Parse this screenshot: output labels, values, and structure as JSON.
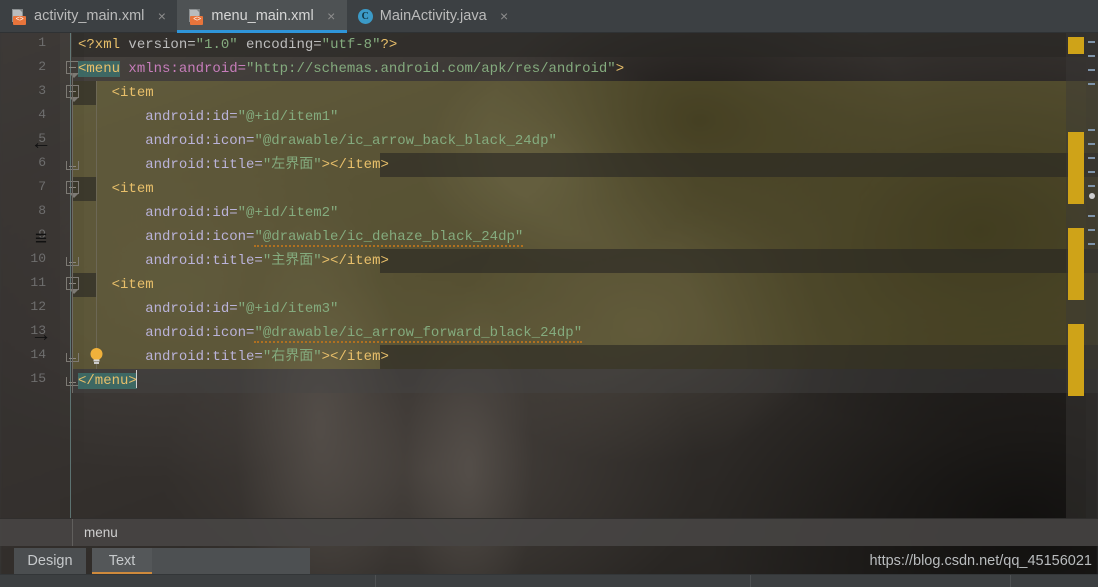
{
  "window": {
    "tabs": [
      {
        "label": "activity_main.xml",
        "icon": "xml-file-icon",
        "active": false,
        "close": "×"
      },
      {
        "label": "menu_main.xml",
        "icon": "xml-file-icon",
        "active": true,
        "close": "×"
      },
      {
        "label": "MainActivity.java",
        "icon": "java-class-icon",
        "active": false,
        "close": "×"
      }
    ]
  },
  "editor": {
    "line_numbers": [
      "1",
      "2",
      "3",
      "4",
      "5",
      "6",
      "7",
      "8",
      "9",
      "10",
      "11",
      "12",
      "13",
      "14",
      "15"
    ],
    "gutter_icons": [
      {
        "line": 5,
        "name": "arrow-back-icon",
        "glyph": "←"
      },
      {
        "line": 9,
        "name": "dehaze-icon",
        "glyph": "≡"
      },
      {
        "line": 13,
        "name": "arrow-forward-icon",
        "glyph": "→"
      },
      {
        "line": 14,
        "name": "intention-bulb-icon",
        "glyph": "💡"
      }
    ],
    "lines": [
      {
        "n": 1,
        "text": "<?xml version=\"1.0\" encoding=\"utf-8\"?>"
      },
      {
        "n": 2,
        "text": "<menu xmlns:android=\"http://schemas.android.com/apk/res/android\">"
      },
      {
        "n": 3,
        "text": "    <item"
      },
      {
        "n": 4,
        "text": "        android:id=\"@+id/item1\""
      },
      {
        "n": 5,
        "text": "        android:icon=\"@drawable/ic_arrow_back_black_24dp\""
      },
      {
        "n": 6,
        "text": "        android:title=\"左界面\"></item>"
      },
      {
        "n": 7,
        "text": "    <item"
      },
      {
        "n": 8,
        "text": "        android:id=\"@+id/item2\""
      },
      {
        "n": 9,
        "text": "        android:icon=\"@drawable/ic_dehaze_black_24dp\""
      },
      {
        "n": 10,
        "text": "        android:title=\"主界面\"></item>"
      },
      {
        "n": 11,
        "text": "    <item"
      },
      {
        "n": 12,
        "text": "        android:id=\"@+id/item3\""
      },
      {
        "n": 13,
        "text": "        android:icon=\"@drawable/ic_arrow_forward_black_24dp\""
      },
      {
        "n": 14,
        "text": "        android:title=\"右界面\"></item>"
      },
      {
        "n": 15,
        "text": "</menu>"
      }
    ],
    "tokens": {
      "xml_decl_open": "<?xml",
      "xml_ver_name": " version=",
      "xml_ver_val": "\"1.0\"",
      "xml_enc_name": " encoding=",
      "xml_enc_val": "\"utf-8\"",
      "xml_decl_close": "?>",
      "menu_open": "<menu",
      "xmlns_attr": " xmlns:android=",
      "xmlns_val": "\"http://schemas.android.com/apk/res/android\"",
      "gt": ">",
      "item_open": "<item",
      "attr_id": "android:id=",
      "attr_icon": "android:icon=",
      "attr_title": "android:title=",
      "eq": "",
      "id1": "\"@+id/item1\"",
      "id2": "\"@+id/item2\"",
      "id3": "\"@+id/item3\"",
      "icon1": "\"@drawable/ic_arrow_back_black_24dp\"",
      "icon2": "\"@drawable/ic_dehaze_black_24dp\"",
      "icon3": "\"@drawable/ic_arrow_forward_black_24dp\"",
      "title1": "\"左界面\"",
      "title2": "\"主界面\"",
      "title3": "\"右界面\"",
      "item_close": "></item>",
      "menu_close": "</menu>"
    }
  },
  "breadcrumb": {
    "path": "menu"
  },
  "bottom_tabs": {
    "design": "Design",
    "text": "Text",
    "selected": "Text"
  },
  "watermark": {
    "url": "https://blog.csdn.net/qq_45156021"
  },
  "colors": {
    "accent_tab": "#2f95d9",
    "selected_underline": "#cf8a3c",
    "warning_marker": "#cfa318",
    "tag": "#e8bf6a",
    "attribute": "#bab3d9",
    "string": "#84ab7e",
    "namespace": "#c77dbb"
  }
}
